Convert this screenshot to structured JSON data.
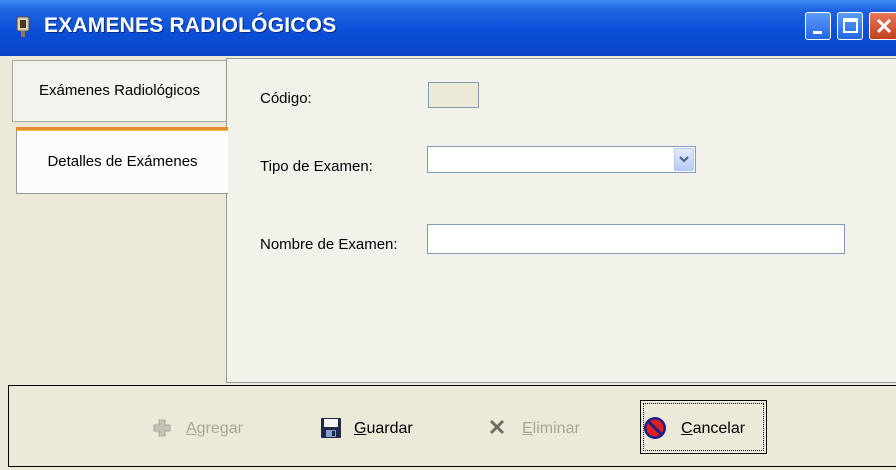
{
  "window": {
    "title": "EXAMENES RADIOLÓGICOS"
  },
  "tabs": [
    {
      "label": "Exámenes Radiológicos",
      "selected": false
    },
    {
      "label": "Detalles de Exámenes",
      "selected": true
    }
  ],
  "form": {
    "codigo_label": "Código:",
    "codigo_value": "",
    "tipo_label": "Tipo de Examen:",
    "tipo_value": "",
    "nombre_label": "Nombre de Examen:",
    "nombre_value": ""
  },
  "toolbar": {
    "agregar": {
      "mnemonic": "A",
      "rest": "gregar",
      "enabled": false
    },
    "guardar": {
      "mnemonic": "G",
      "rest": "uardar",
      "enabled": true
    },
    "eliminar": {
      "mnemonic": "E",
      "rest": "liminar",
      "enabled": false
    },
    "cancelar": {
      "mnemonic": "C",
      "rest": "ancelar",
      "enabled": true
    }
  },
  "colors": {
    "titlebar": "#0a4fd8",
    "window_bg": "#ece9d8",
    "disabled_text": "#a7a695"
  },
  "icons": {
    "app": "radiology-app-icon",
    "agregar": "plus-icon",
    "guardar": "floppy-disk-icon",
    "eliminar": "x-delete-icon",
    "cancelar": "no-entry-icon",
    "dropdown": "chevron-down-icon"
  }
}
